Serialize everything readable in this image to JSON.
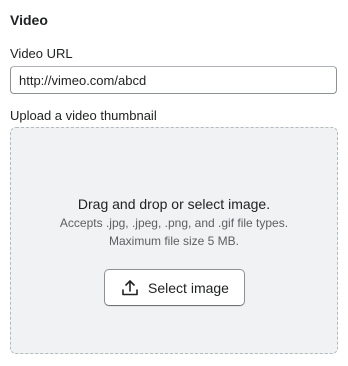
{
  "section": {
    "title": "Video"
  },
  "video_url": {
    "label": "Video URL",
    "value": "http://vimeo.com/abcd"
  },
  "thumbnail": {
    "label": "Upload a video thumbnail",
    "dropzone": {
      "heading": "Drag and drop or select image.",
      "accepted_types": "Accepts .jpg, .jpeg, .png, and .gif file types.",
      "max_size": "Maximum file size 5 MB.",
      "button_label": "Select image",
      "button_icon": "upload-icon"
    }
  }
}
